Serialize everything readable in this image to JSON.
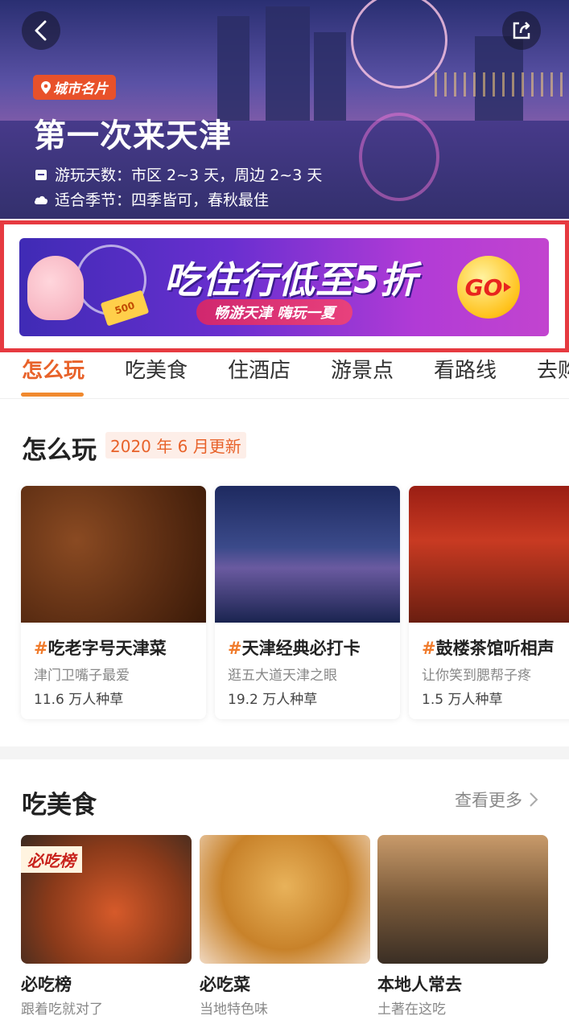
{
  "hero": {
    "badge": "城市名片",
    "title": "第一次来天津",
    "days_label": "游玩天数：市区 2~3 天，周边 2~3 天",
    "season_label": "适合季节：四季皆可，春秋最佳"
  },
  "promo": {
    "headline": "吃住行低至5折",
    "sub": "畅游天津 嗨玩一夏",
    "go": "GO",
    "coupon": "500"
  },
  "tabs": [
    "怎么玩",
    "吃美食",
    "住酒店",
    "游景点",
    "看路线",
    "去购"
  ],
  "play": {
    "title": "怎么玩",
    "update": "2020 年 6 月更新",
    "cards": [
      {
        "hash": "#",
        "title": "吃老字号天津菜",
        "sub": "津门卫嘴子最爱",
        "count": "11.6 万人种草"
      },
      {
        "hash": "#",
        "title": "天津经典必打卡",
        "sub": "逛五大道天津之眼",
        "count": "19.2 万人种草"
      },
      {
        "hash": "#",
        "title": "鼓楼茶馆听相声",
        "sub": "让你笑到腮帮子疼",
        "count": "1.5 万人种草"
      }
    ]
  },
  "eat": {
    "title": "吃美食",
    "more": "查看更多",
    "cards": [
      {
        "title": "必吃榜",
        "sub": "跟着吃就对了",
        "tag": "必吃榜"
      },
      {
        "title": "必吃菜",
        "sub": "当地特色味"
      },
      {
        "title": "本地人常去",
        "sub": "土著在这吃"
      }
    ]
  },
  "colors": {
    "accent": "#e8622a",
    "promo_frame": "#e63a40"
  }
}
